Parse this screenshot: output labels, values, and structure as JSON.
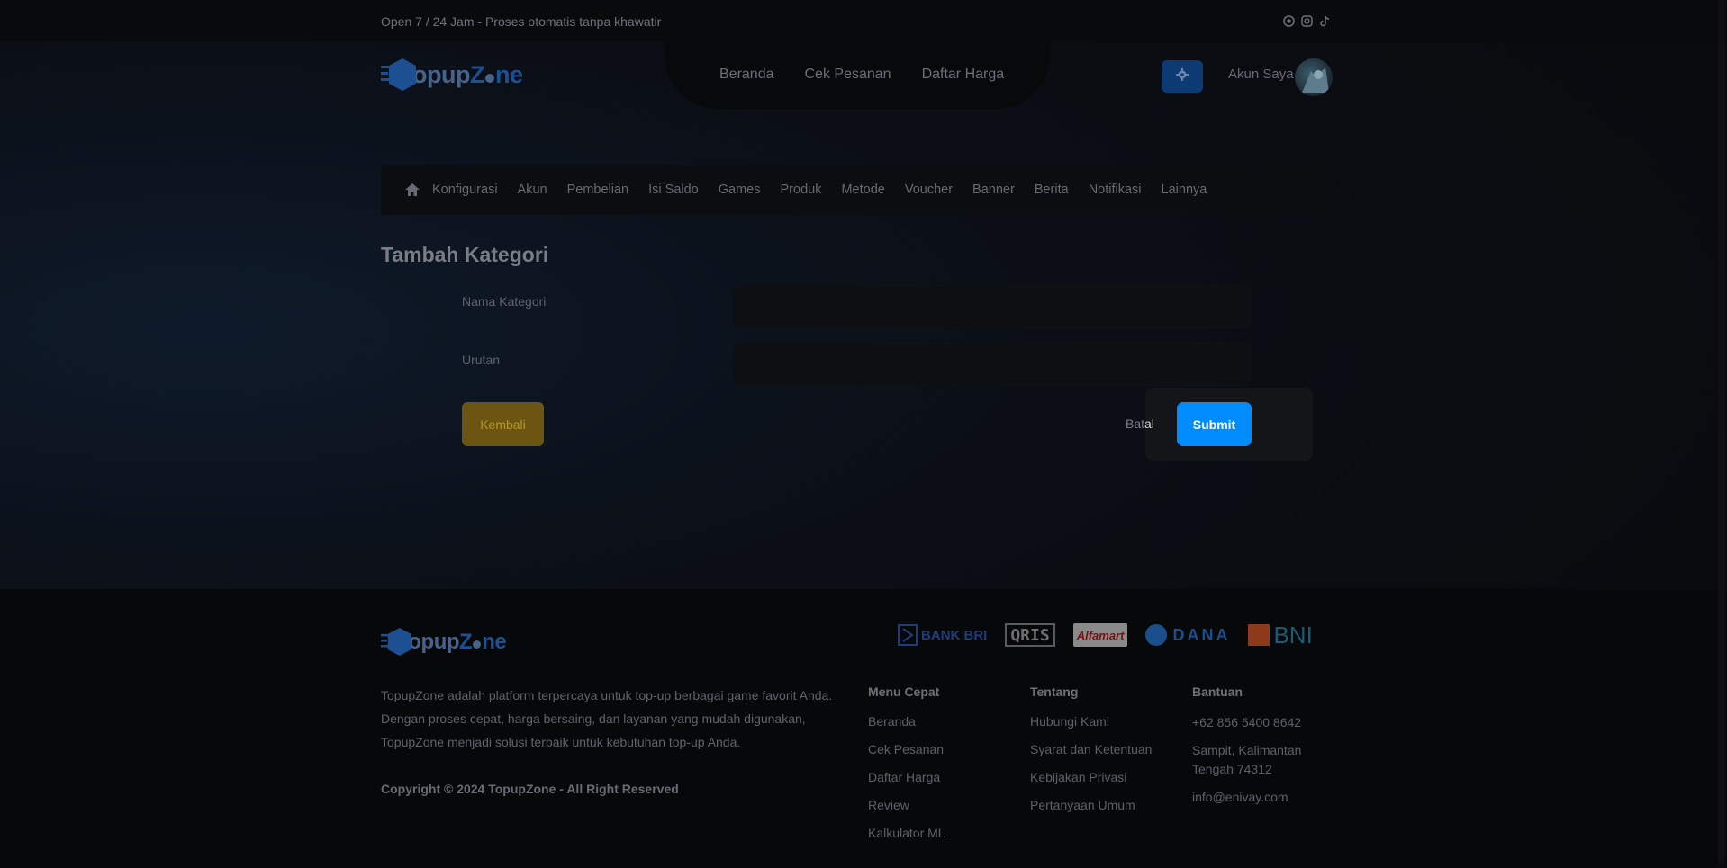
{
  "topbar": {
    "tagline": "Open 7 / 24 Jam - Proses otomatis tanpa khawatir",
    "socials": [
      "whatsapp-icon",
      "instagram-icon",
      "tiktok-icon"
    ]
  },
  "brand": {
    "name_part1": "Topup",
    "name_part2": "Z",
    "name_part3": "ne"
  },
  "nav": {
    "items": [
      "Beranda",
      "Cek Pesanan",
      "Daftar Harga"
    ]
  },
  "account": {
    "label": "Akun Saya"
  },
  "admin_nav": {
    "items": [
      "Konfigurasi",
      "Akun",
      "Pembelian",
      "Isi Saldo",
      "Games",
      "Produk",
      "Metode",
      "Voucher",
      "Banner",
      "Berita",
      "Notifikasi",
      "Lainnya"
    ]
  },
  "form": {
    "title": "Tambah Kategori",
    "fields": [
      {
        "label": "Nama Kategori",
        "value": ""
      },
      {
        "label": "Urutan",
        "value": ""
      }
    ],
    "back_label": "Kembali",
    "cancel_label_a": "Bat",
    "cancel_label_b": "al",
    "submit_label": "Submit"
  },
  "footer": {
    "payments": [
      "BANK BRI",
      "QRIS",
      "Alfamart",
      "DANA",
      "BNI"
    ],
    "description": "TopupZone adalah platform terpercaya untuk top-up berbagai game favorit Anda. Dengan proses cepat, harga bersaing, dan layanan yang mudah digunakan, TopupZone menjadi solusi terbaik untuk kebutuhan top-up Anda.",
    "copyright": "Copyright © 2024 TopupZone - All Right Reserved",
    "menu_cepat": {
      "title": "Menu Cepat",
      "links": [
        "Beranda",
        "Cek Pesanan",
        "Daftar Harga",
        "Review",
        "Kalkulator ML"
      ]
    },
    "tentang": {
      "title": "Tentang",
      "links": [
        "Hubungi Kami",
        "Syarat dan Ketentuan",
        "Kebijakan Privasi",
        "Pertanyaan Umum"
      ]
    },
    "bantuan": {
      "title": "Bantuan",
      "items": [
        "+62 856 5400 8642",
        "Sampit, Kalimantan Tengah 74312",
        "info@enivay.com"
      ]
    }
  },
  "colors": {
    "accent": "#008cff",
    "back_button": "#6b5510",
    "brand_blue": "#1d4f93"
  }
}
